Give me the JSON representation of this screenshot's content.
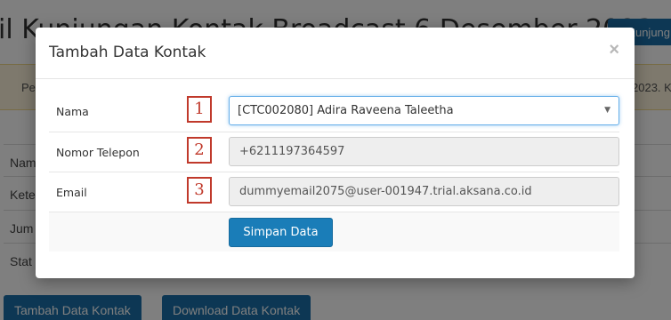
{
  "background": {
    "page_title": "il Kunjungan Kontak Broadcast 6 Desember 2023",
    "visit_button_label": "Kunjung",
    "notice_left": "Pe",
    "notice_right": "2023. K",
    "rows": [
      "Nam",
      "Kete",
      "Jum",
      "Stat"
    ],
    "add_contact_button": "Tambah Data Kontak",
    "download_contact_button": "Download Data Kontak"
  },
  "modal": {
    "title": "Tambah Data Kontak",
    "close_label": "×",
    "fields": [
      {
        "badge": "1",
        "label": "Nama",
        "value": "[CTC002080] Adira Raveena Taleetha"
      },
      {
        "badge": "2",
        "label": "Nomor Telepon",
        "value": "+6211197364597"
      },
      {
        "badge": "3",
        "label": "Email",
        "value": "dummyemail2075@user-001947.trial.aksana.co.id"
      }
    ],
    "save_button": "Simpan Data"
  },
  "colors": {
    "primary": "#1a7db8",
    "badge_border": "#c0392b",
    "notice_bg": "#fcf3da"
  },
  "icons": {
    "visit": "calendar-icon",
    "dropdown": "caret-down-icon",
    "close": "close-icon"
  }
}
